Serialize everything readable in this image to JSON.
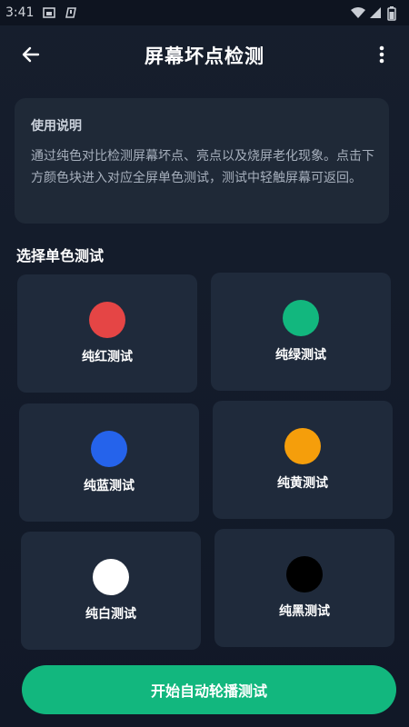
{
  "status_bar": {
    "time": "3:41",
    "icons": [
      "image-icon",
      "alert-icon",
      "wifi-icon",
      "signal-icon",
      "battery-icon"
    ]
  },
  "toolbar": {
    "title": "屏幕坏点检测",
    "back_icon": "arrow-left-icon",
    "more_icon": "more-vertical-icon"
  },
  "instructions": {
    "title": "使用说明",
    "body": "通过纯色对比检测屏幕坏点、亮点以及烧屏老化现象。点击下方颜色块进入对应全屏单色测试，测试中轻触屏幕可返回。"
  },
  "section_title": "选择单色测试",
  "tiles": [
    {
      "label": "纯红测试",
      "color": "#e54545"
    },
    {
      "label": "纯绿测试",
      "color": "#12b77e"
    },
    {
      "label": "纯蓝测试",
      "color": "#2563eb"
    },
    {
      "label": "纯黄测试",
      "color": "#f59e0b"
    },
    {
      "label": "纯白测试",
      "color": "#ffffff"
    },
    {
      "label": "纯黑测试",
      "color": "#000000"
    }
  ],
  "start_button": {
    "label": "开始自动轮播测试",
    "color": "#12b77e"
  }
}
